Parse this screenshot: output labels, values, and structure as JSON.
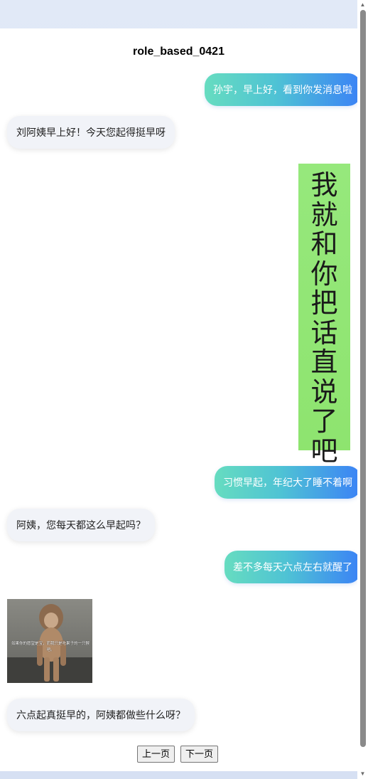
{
  "page": {
    "title": "role_based_0421"
  },
  "messages": [
    {
      "side": "right",
      "text": "孙宇，早上好，看到你发消息啦"
    },
    {
      "side": "left",
      "text": "刘阿姨早上好！今天您起得挺早呀"
    },
    {
      "side": "right",
      "type": "sticker",
      "text": "我就和你把话直说了吧"
    },
    {
      "side": "right",
      "text": "习惯早起，年纪大了睡不着啊"
    },
    {
      "side": "left",
      "text": "阿姨，您每天都这么早起吗？"
    },
    {
      "side": "right",
      "text": "差不多每天六点左右就醒了"
    },
    {
      "side": "left",
      "type": "image",
      "caption": "如果你的愿望是宝，而我只是吃果子的一只猴吧。"
    },
    {
      "side": "left",
      "text": "六点起真挺早的，阿姨都做些什么呀？"
    }
  ],
  "pager": {
    "prev": "上一页",
    "next": "下一页"
  },
  "colors": {
    "right_bubble_start": "#66dcc0",
    "right_bubble_end": "#3b82f6",
    "left_bubble": "#f1f3f8",
    "sticker_bg": "#8ee46f"
  }
}
